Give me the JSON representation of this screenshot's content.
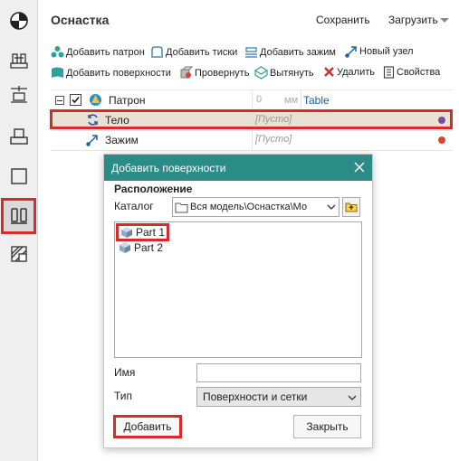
{
  "sidebar": {
    "icons": [
      "target-icon",
      "fixture-icon",
      "align-icon",
      "base-icon",
      "square-icon",
      "clamp-icon",
      "section-icon"
    ]
  },
  "header": {
    "title": "Оснастка",
    "save_label": "Сохранить",
    "load_label": "Загрузить"
  },
  "commands": {
    "add_chuck": "Добавить патрон",
    "add_vise": "Добавить тиски",
    "add_clamp": "Добавить зажим",
    "new_node": "Новый узел",
    "add_surfaces": "Добавить поверхности",
    "rotate": "Провернуть",
    "extrude": "Вытянуть",
    "delete": "Удалить",
    "properties": "Свойства"
  },
  "tree": {
    "rows": [
      {
        "label": "Патрон",
        "value": "0",
        "unit": "мм",
        "extra": "Table"
      },
      {
        "label": "Тело",
        "value": "[Пусто]",
        "dot_color": "#7b4a9e"
      },
      {
        "label": "Зажим",
        "value": "[Пусто]",
        "dot_color": "#d9432f"
      }
    ]
  },
  "dialog": {
    "title": "Добавить поверхности",
    "location_label": "Расположение",
    "catalog_label": "Каталог",
    "catalog_value": "Вся модель\\Оснастка\\Мо",
    "parts": [
      "Part 1",
      "Part 2"
    ],
    "name_label": "Имя",
    "name_value": "",
    "type_label": "Тип",
    "type_value": "Поверхности и сетки",
    "add_button": "Добавить",
    "close_button": "Закрыть"
  },
  "colors": {
    "accent": "#2b8b86",
    "highlight": "#d62b2b",
    "selected_row": "#e9e2d3",
    "link": "#1f5fae"
  }
}
